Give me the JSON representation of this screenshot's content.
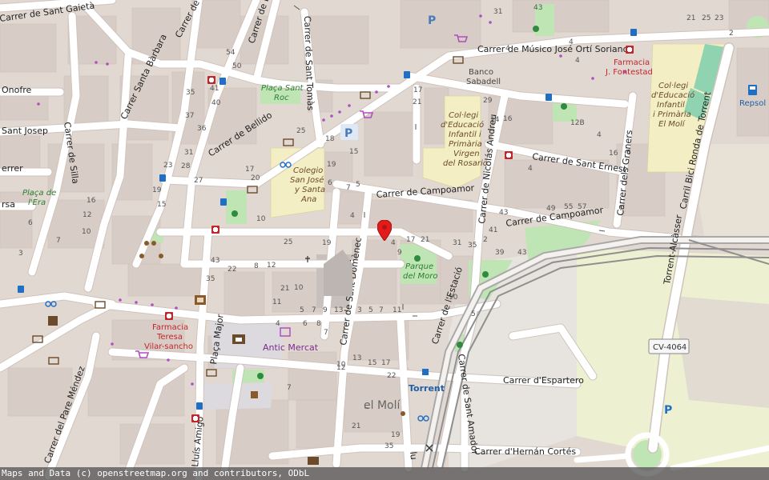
{
  "colors": {
    "land": "#e2d8d2",
    "block": "#d9cfc8",
    "road": "#ffffff",
    "casing": "#cfc4bd",
    "park": "#b9e3b2",
    "school": "#f4efc4",
    "rail": "#8f8f8f",
    "industrial": "#ebe5d8",
    "farmland": "#eef0d2",
    "marker": "#e21b1b"
  },
  "streets": {
    "sant_gaieta": "Carrer de Sant Gaietà",
    "santa_barbara": "Carrer Santa Bàrbara",
    "silla": "Carrer de Silla",
    "sant_onofre": "Onofre",
    "sant_josep": "Sant Josep",
    "ferrer": "errer",
    "rsa": "rsa",
    "sant_tomas": "Carrer de Sant Tomàs",
    "bellido": "Carrer de Bellido",
    "musico": "Carrer de Músico José Ortí Soriano",
    "campoamor1": "Carrer de Campoamor",
    "campoamor2": "Carrer de Campoamor",
    "sant_ernest": "Carrer de Sant Ernest",
    "nicolas": "Carrer de Nicolás Andreu",
    "graners": "Carrer dels Graners",
    "ronda": "Carril Bici Ronda de Torrent",
    "sant_domenec": "Carrer de Sant Domènec",
    "estacio": "Carrer de l'Estació",
    "sant_amador": "Carrer de Sant Amador",
    "espartero": "Carrer d'Espartero",
    "hernan": "Carrer d'Hernán Cortés",
    "pare_mendez": "Carrer del Pare Méndez",
    "placa_major": "Plaça Major",
    "lluis_amigo": "Lluís Amigó",
    "torrent_alcasser": "Torrent-Alcàsser",
    "top_x": "Carrer de X",
    "top_d": "Carrer de D",
    "lu": "lu"
  },
  "pois": {
    "placa_sant_roc": [
      "Plaça Sant",
      "Roc"
    ],
    "placa_era": [
      "Plaça de",
      "l'Era"
    ],
    "banco": [
      "Banco",
      "Sabadell"
    ],
    "farmacia_fontestad": [
      "Farmacia",
      "J. Fontestad"
    ],
    "farmacia_teresa": [
      "Farmacia",
      "Teresa",
      "Vilar-sancho"
    ],
    "col_rosario": [
      "Col·legi",
      "d'Educació",
      "Infantil i",
      "Primària",
      "Virgen",
      "del Rosario"
    ],
    "col_moli": [
      "Col·legi",
      "d'Educació",
      "Infantil",
      "i Primària",
      "El Molí"
    ],
    "colegio_sj": [
      "Colegio",
      "San José",
      "y Santa",
      "Ana"
    ],
    "parque_moro": [
      "Parque",
      "del Moro"
    ],
    "antic_mercat": "Antic Mercat",
    "torrent": "Torrent",
    "el_moli": "el Molí",
    "repsol": "Repsol",
    "cv_road": "CV-4064"
  },
  "house_numbers": [
    [
      "50",
      "290",
      "85"
    ],
    [
      "54",
      "282",
      "68"
    ],
    [
      "41",
      "262",
      "113"
    ],
    [
      "40",
      "264",
      "131"
    ],
    [
      "35",
      "232",
      "118"
    ],
    [
      "36",
      "246",
      "163"
    ],
    [
      "37",
      "231",
      "147"
    ],
    [
      "31",
      "230",
      "193"
    ],
    [
      "28",
      "226",
      "210"
    ],
    [
      "27",
      "242",
      "228"
    ],
    [
      "23",
      "204",
      "209"
    ],
    [
      "19",
      "190",
      "240"
    ],
    [
      "15",
      "196",
      "258"
    ],
    [
      "16",
      "108",
      "253"
    ],
    [
      "12",
      "103",
      "271"
    ],
    [
      "10",
      "102",
      "292"
    ],
    [
      "7",
      "70",
      "303"
    ],
    [
      "6",
      "35",
      "281"
    ],
    [
      "3",
      "23",
      "319"
    ],
    [
      "43",
      "263",
      "328"
    ],
    [
      "35",
      "257",
      "351"
    ],
    [
      "22",
      "284",
      "339"
    ],
    [
      "8",
      "317",
      "335"
    ],
    [
      "12",
      "333",
      "334"
    ],
    [
      "25",
      "354",
      "305"
    ],
    [
      "19",
      "402",
      "306"
    ],
    [
      "21",
      "350",
      "363"
    ],
    [
      "11",
      "340",
      "380"
    ],
    [
      "10",
      "367",
      "362"
    ],
    [
      "5",
      "374",
      "390"
    ],
    [
      "7",
      "389",
      "390"
    ],
    [
      "9",
      "403",
      "390"
    ],
    [
      "13",
      "417",
      "390"
    ],
    [
      "3",
      "446",
      "390"
    ],
    [
      "5",
      "460",
      "390"
    ],
    [
      "7",
      "473",
      "390"
    ],
    [
      "11",
      "490",
      "390"
    ],
    [
      "4",
      "344",
      "407"
    ],
    [
      "6",
      "378",
      "407"
    ],
    [
      "8",
      "395",
      "407"
    ],
    [
      "7",
      "358",
      "487"
    ],
    [
      "10",
      "420",
      "458"
    ],
    [
      "12",
      "420",
      "462"
    ],
    [
      "13",
      "440",
      "450"
    ],
    [
      "15",
      "459",
      "456"
    ],
    [
      "17",
      "476",
      "456"
    ],
    [
      "22",
      "483",
      "472"
    ],
    [
      "35",
      "480",
      "560"
    ],
    [
      "21",
      "439",
      "535"
    ],
    [
      "19",
      "488",
      "546"
    ],
    [
      "17",
      "516",
      "115"
    ],
    [
      "21",
      "515",
      "130"
    ],
    [
      "29",
      "603",
      "128"
    ],
    [
      "12B",
      "712",
      "156"
    ],
    [
      "16",
      "628",
      "151"
    ],
    [
      "14",
      "612",
      "152"
    ],
    [
      "4",
      "659",
      "213"
    ],
    [
      "55",
      "704",
      "261"
    ],
    [
      "57",
      "721",
      "261"
    ],
    [
      "49",
      "682",
      "263"
    ],
    [
      "43",
      "623",
      "268"
    ],
    [
      "41",
      "610",
      "290"
    ],
    [
      "35",
      "584",
      "309"
    ],
    [
      "31",
      "565",
      "306"
    ],
    [
      "21",
      "525",
      "302"
    ],
    [
      "17",
      "507",
      "302"
    ],
    [
      "9",
      "496",
      "318"
    ],
    [
      "4",
      "488",
      "306"
    ],
    [
      "2",
      "603",
      "302"
    ],
    [
      "39",
      "618",
      "318"
    ],
    [
      "43",
      "646",
      "318"
    ],
    [
      "5",
      "588",
      "395"
    ],
    [
      "10",
      "560",
      "374"
    ],
    [
      "7",
      "404",
      "418"
    ],
    [
      "6",
      "409",
      "231"
    ],
    [
      "5",
      "444",
      "233"
    ],
    [
      "7",
      "432",
      "237"
    ],
    [
      "4",
      "437",
      "272"
    ],
    [
      "15",
      "436",
      "192"
    ],
    [
      "18",
      "406",
      "176"
    ],
    [
      "19",
      "408",
      "208"
    ],
    [
      "25",
      "370",
      "166"
    ],
    [
      "17",
      "306",
      "214"
    ],
    [
      "20",
      "313",
      "225"
    ],
    [
      "10",
      "320",
      "276"
    ],
    [
      "21",
      "857",
      "25"
    ],
    [
      "25",
      "876",
      "25"
    ],
    [
      "23",
      "892",
      "25"
    ],
    [
      "2",
      "910",
      "44"
    ],
    [
      "31",
      "616",
      "17"
    ],
    [
      "43",
      "666",
      "12"
    ],
    [
      "4",
      "631",
      "63"
    ],
    [
      "4",
      "710",
      "55"
    ],
    [
      "4",
      "718",
      "78"
    ],
    [
      "6",
      "782",
      "193"
    ],
    [
      "16",
      "760",
      "194"
    ],
    [
      "4",
      "745",
      "171"
    ]
  ],
  "attribution": "Maps and Data (c) openstreetmap.org and contributors, ODbL"
}
